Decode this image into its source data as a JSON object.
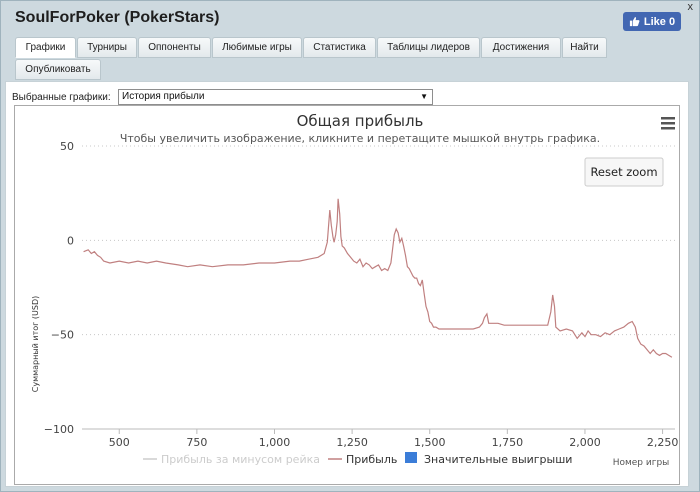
{
  "window": {
    "title": "SoulForPoker (PokerStars)",
    "close": "x"
  },
  "facebook": {
    "like_label": "Like 0"
  },
  "tabs": [
    {
      "label": "Графики",
      "active": true
    },
    {
      "label": "Турниры"
    },
    {
      "label": "Оппоненты"
    },
    {
      "label": "Любимые игры"
    },
    {
      "label": "Статистика"
    },
    {
      "label": "Таблицы лидеров"
    },
    {
      "label": "Достижения"
    },
    {
      "label": "Найти"
    },
    {
      "label": "Опубликовать"
    }
  ],
  "selector": {
    "label": "Выбранные графики:",
    "value": "История прибыли"
  },
  "chart": {
    "reset_zoom": "Reset zoom",
    "menu_icon": "hamburger-menu-icon"
  },
  "chart_data": {
    "type": "line",
    "title": "Общая прибыль",
    "subtitle": "Чтобы увеличить изображение, кликните и перетащите мышкой внутрь графика.",
    "xlabel": "Номер игры",
    "ylabel": "Суммарный итог (USD)",
    "xlim": [
      380,
      2290
    ],
    "ylim": [
      -100,
      50
    ],
    "x_ticks": [
      500,
      750,
      1000,
      1250,
      1500,
      1750,
      2000,
      2250
    ],
    "x_tick_labels": [
      "500",
      "750",
      "1,000",
      "1,250",
      "1,500",
      "1,750",
      "2,000",
      "2,250"
    ],
    "y_ticks": [
      50,
      0,
      -50,
      -100
    ],
    "y_tick_labels": [
      "50",
      "0",
      "−50",
      "−100"
    ],
    "grid": true,
    "legend_position": "bottom",
    "legend": [
      {
        "name": "Прибыль за минусом рейка",
        "color": "#cccccc",
        "kind": "line",
        "hidden": true
      },
      {
        "name": "Прибыль",
        "color": "#c08080",
        "kind": "line"
      },
      {
        "name": "Значительные выигрыши",
        "color": "#3b7dd8",
        "kind": "box"
      }
    ],
    "series": [
      {
        "name": "Прибыль",
        "color": "#c08080",
        "points": [
          [
            385,
            -6
          ],
          [
            400,
            -5
          ],
          [
            410,
            -7
          ],
          [
            420,
            -6
          ],
          [
            430,
            -8
          ],
          [
            440,
            -9
          ],
          [
            450,
            -11
          ],
          [
            470,
            -12
          ],
          [
            500,
            -11
          ],
          [
            530,
            -12
          ],
          [
            560,
            -11
          ],
          [
            590,
            -12
          ],
          [
            620,
            -11
          ],
          [
            650,
            -12
          ],
          [
            690,
            -13
          ],
          [
            720,
            -14
          ],
          [
            760,
            -13
          ],
          [
            800,
            -14
          ],
          [
            850,
            -13
          ],
          [
            900,
            -13
          ],
          [
            950,
            -12
          ],
          [
            1000,
            -12
          ],
          [
            1050,
            -11
          ],
          [
            1080,
            -11
          ],
          [
            1110,
            -10
          ],
          [
            1140,
            -9
          ],
          [
            1160,
            -7
          ],
          [
            1170,
            -1
          ],
          [
            1178,
            16
          ],
          [
            1183,
            8
          ],
          [
            1188,
            2
          ],
          [
            1192,
            -1
          ],
          [
            1197,
            3
          ],
          [
            1202,
            10
          ],
          [
            1205,
            22
          ],
          [
            1210,
            14
          ],
          [
            1214,
            2
          ],
          [
            1218,
            -3
          ],
          [
            1225,
            -4
          ],
          [
            1235,
            -7
          ],
          [
            1245,
            -9
          ],
          [
            1255,
            -11
          ],
          [
            1265,
            -12
          ],
          [
            1275,
            -10
          ],
          [
            1285,
            -14
          ],
          [
            1295,
            -12
          ],
          [
            1305,
            -13
          ],
          [
            1315,
            -15
          ],
          [
            1325,
            -14
          ],
          [
            1335,
            -13
          ],
          [
            1345,
            -16
          ],
          [
            1355,
            -15
          ],
          [
            1365,
            -16
          ],
          [
            1375,
            -12
          ],
          [
            1380,
            -5
          ],
          [
            1386,
            3
          ],
          [
            1392,
            6
          ],
          [
            1398,
            4
          ],
          [
            1404,
            -1
          ],
          [
            1410,
            1
          ],
          [
            1416,
            -3
          ],
          [
            1422,
            -8
          ],
          [
            1428,
            -14
          ],
          [
            1434,
            -15
          ],
          [
            1440,
            -17
          ],
          [
            1446,
            -19
          ],
          [
            1452,
            -20
          ],
          [
            1458,
            -20
          ],
          [
            1464,
            -23
          ],
          [
            1470,
            -24
          ],
          [
            1476,
            -21
          ],
          [
            1482,
            -28
          ],
          [
            1488,
            -35
          ],
          [
            1494,
            -38
          ],
          [
            1500,
            -43
          ],
          [
            1506,
            -44
          ],
          [
            1512,
            -46
          ],
          [
            1520,
            -46
          ],
          [
            1530,
            -47
          ],
          [
            1560,
            -47
          ],
          [
            1600,
            -47
          ],
          [
            1640,
            -47
          ],
          [
            1660,
            -46
          ],
          [
            1670,
            -44
          ],
          [
            1676,
            -41
          ],
          [
            1684,
            -39
          ],
          [
            1690,
            -44
          ],
          [
            1700,
            -44
          ],
          [
            1720,
            -44
          ],
          [
            1740,
            -45
          ],
          [
            1760,
            -45
          ],
          [
            1780,
            -45
          ],
          [
            1800,
            -45
          ],
          [
            1830,
            -45
          ],
          [
            1860,
            -45
          ],
          [
            1880,
            -45
          ],
          [
            1890,
            -38
          ],
          [
            1896,
            -29
          ],
          [
            1902,
            -35
          ],
          [
            1906,
            -46
          ],
          [
            1920,
            -48
          ],
          [
            1940,
            -47
          ],
          [
            1960,
            -48
          ],
          [
            1975,
            -52
          ],
          [
            1990,
            -49
          ],
          [
            2000,
            -51
          ],
          [
            2010,
            -48
          ],
          [
            2020,
            -50
          ],
          [
            2035,
            -50
          ],
          [
            2050,
            -51
          ],
          [
            2065,
            -49
          ],
          [
            2080,
            -50
          ],
          [
            2095,
            -48
          ],
          [
            2110,
            -47
          ],
          [
            2125,
            -46
          ],
          [
            2140,
            -44
          ],
          [
            2152,
            -43
          ],
          [
            2162,
            -46
          ],
          [
            2170,
            -52
          ],
          [
            2180,
            -55
          ],
          [
            2190,
            -56
          ],
          [
            2200,
            -58
          ],
          [
            2210,
            -60
          ],
          [
            2220,
            -58
          ],
          [
            2230,
            -60
          ],
          [
            2240,
            -61
          ],
          [
            2250,
            -60
          ],
          [
            2260,
            -60
          ],
          [
            2270,
            -61
          ],
          [
            2280,
            -62
          ]
        ]
      }
    ]
  }
}
